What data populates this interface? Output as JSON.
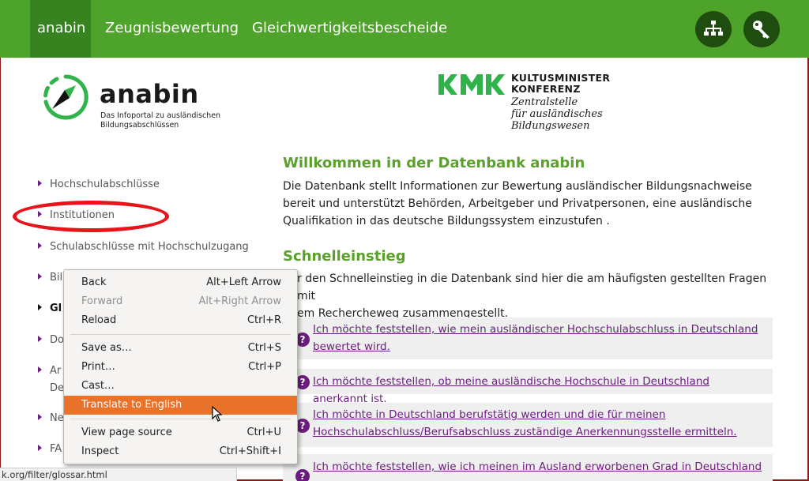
{
  "nav": {
    "items": [
      {
        "label": "anabin",
        "active": true
      },
      {
        "label": "Zeugnisbewertung"
      },
      {
        "label": "Gleichwertigkeitsbescheide"
      }
    ],
    "icons": [
      "sitemap-icon",
      "key-icon"
    ]
  },
  "logo": {
    "name": "anabin",
    "tagline_line1": "Das Infoportal zu ausländischen",
    "tagline_line2": "Bildungsabschlüssen"
  },
  "kmk": {
    "title_line1": "KULTUSMINISTER",
    "title_line2": "KONFERENZ",
    "sub_line1": "Zentralstelle",
    "sub_line2": "für ausländisches",
    "sub_line3": "Bildungswesen"
  },
  "sidebar": {
    "items": [
      {
        "label": "Hochschulabschlüsse"
      },
      {
        "label": "Institutionen"
      },
      {
        "label": "Schulabschlüsse mit Hochschulzugang"
      },
      {
        "label": "Bil"
      },
      {
        "label": "Gl"
      },
      {
        "label": "Do"
      },
      {
        "label": "Ar"
      },
      {
        "label": "De"
      },
      {
        "label": "Ne"
      },
      {
        "label": "FA"
      }
    ]
  },
  "main": {
    "welcome_title": "Willkommen in der Datenbank anabin",
    "welcome_text": "Die Datenbank stellt Informationen zur Bewertung ausländischer Bildungsnachweise bereit und unterstützt Behörden, Arbeitgeber und Privatpersonen, eine ausländische Qualifikation in das deutsche Bildungssystem einzustufen .",
    "quick_title": "Schnelleinstieg",
    "quick_text_line1": "r den Schnelleinstieg in die Datenbank sind hier die am häufigsten gestellten Fragen mit",
    "quick_text_line2": "em Rechercheweg zusammengestellt.",
    "questions": [
      {
        "line1": "Ich möchte feststellen, wie mein ausländischer Hochschulabschluss in Deutschland",
        "line2": "bewertet wird."
      },
      {
        "line1": "Ich möchte feststellen, ob meine ausländische Hochschule in Deutschland anerkannt ist.",
        "line2": ""
      },
      {
        "line1": "Ich möchte in Deutschland berufstätig werden und die für meinen",
        "line2": "Hochschulabschluss/Berufsabschluss zuständige Anerkennungsstelle ermitteln."
      },
      {
        "line1": "Ich möchte feststellen, wie ich meinen im Ausland erworbenen Grad in Deutschland",
        "line2": ""
      }
    ],
    "q_mark": "?"
  },
  "context_menu": {
    "items": [
      {
        "label": "Back",
        "shortcut": "Alt+Left Arrow"
      },
      {
        "label": "Forward",
        "shortcut": "Alt+Right Arrow",
        "disabled": true
      },
      {
        "label": "Reload",
        "shortcut": "Ctrl+R"
      },
      {
        "label": "Save as…",
        "shortcut": "Ctrl+S"
      },
      {
        "label": "Print…",
        "shortcut": "Ctrl+P"
      },
      {
        "label": "Cast…",
        "shortcut": ""
      },
      {
        "label": "Translate to English",
        "shortcut": "",
        "highlighted": true
      },
      {
        "label": "View page source",
        "shortcut": "Ctrl+U"
      },
      {
        "label": "Inspect",
        "shortcut": "Ctrl+Shift+I"
      }
    ]
  },
  "status_url": "k.org/filter/glossar.html",
  "colors": {
    "nav_green": "#4ea42a",
    "heading_green": "#5aa02c",
    "link_purple": "#6b1c7e",
    "menu_highlight": "#e9722b",
    "annotation_red": "#e8141c"
  }
}
